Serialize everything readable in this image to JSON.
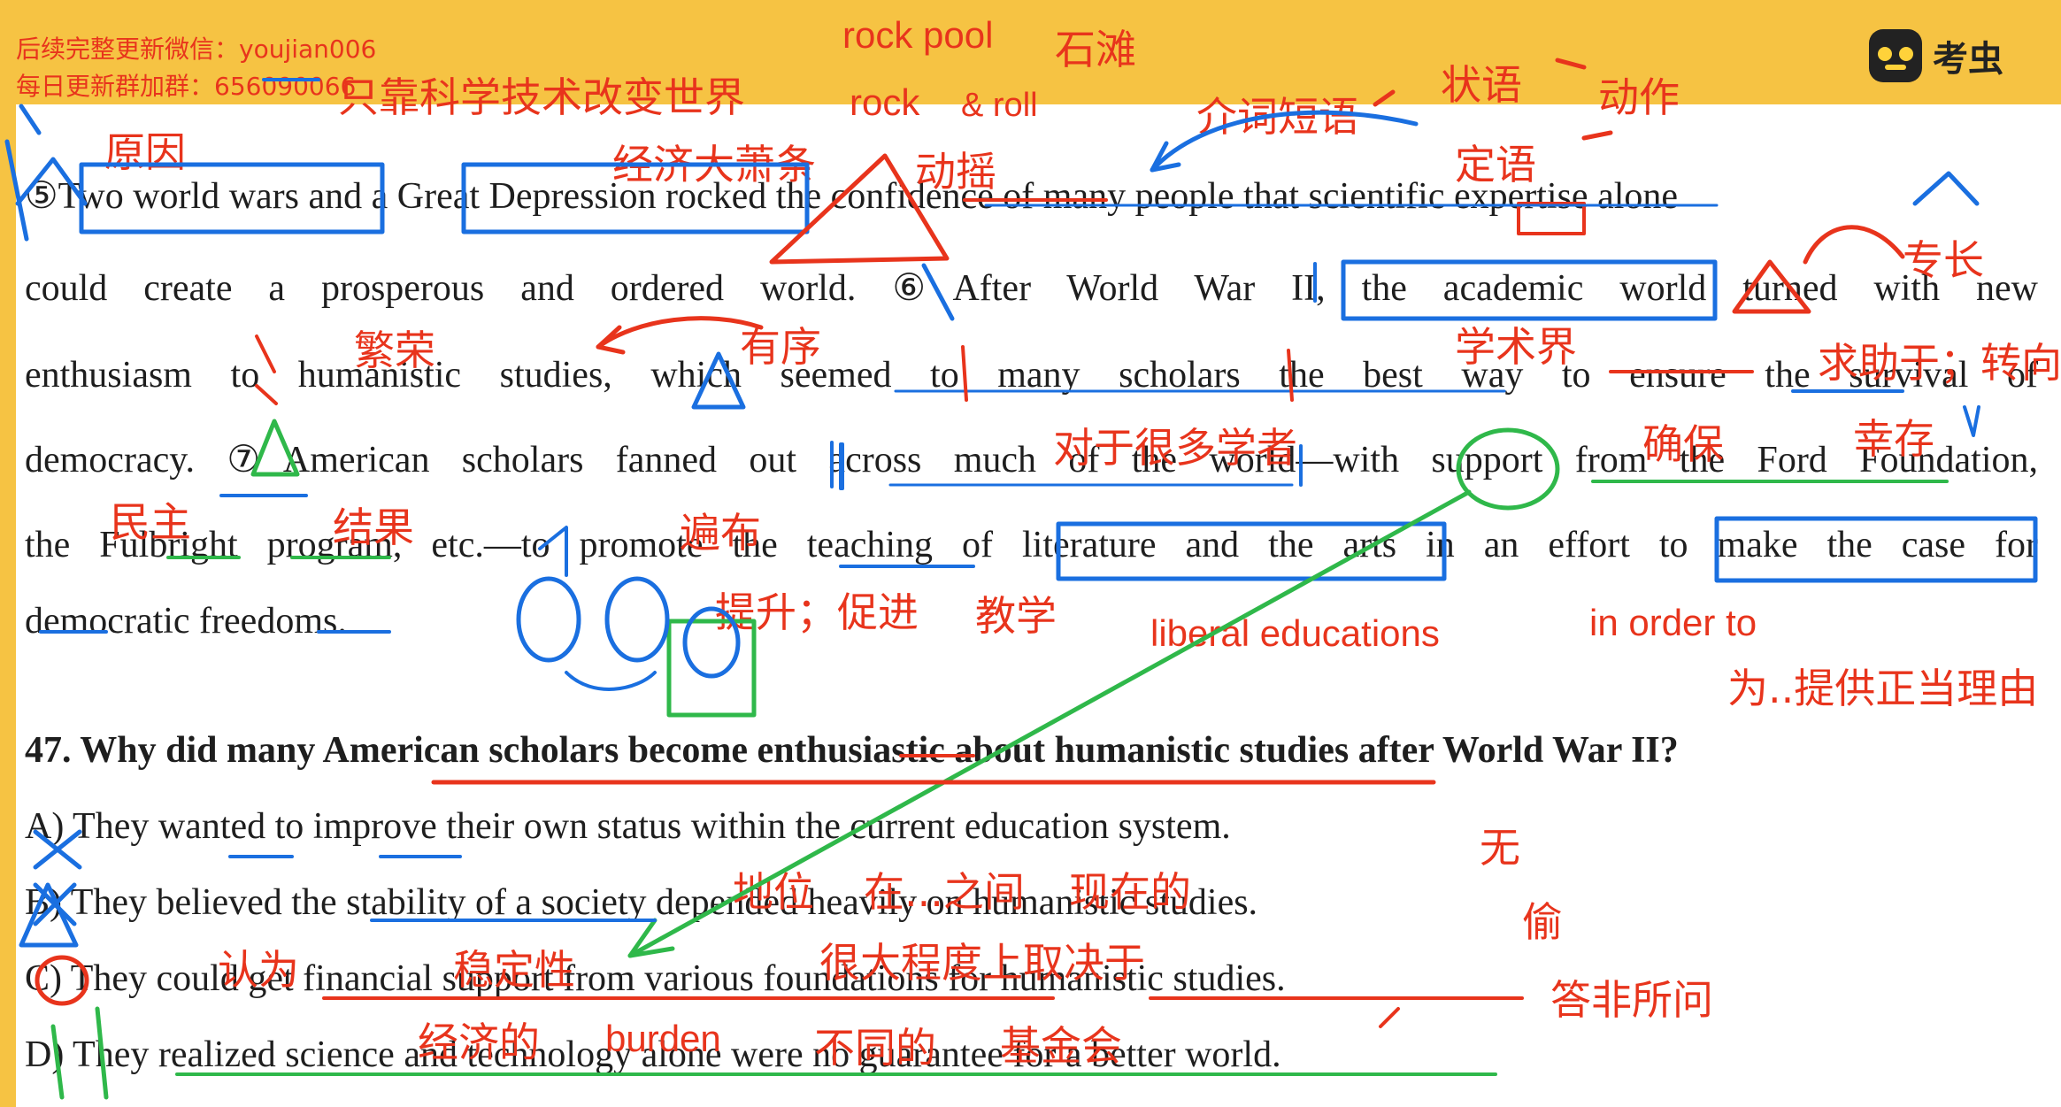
{
  "watermark": {
    "line1": "后续完整更新微信：youjian006",
    "line2": "每日更新群加群：656090066"
  },
  "header_note": "只靠科学技术改变世界",
  "brand": {
    "name": "考虫",
    "icon": "kaochong-logo-icon"
  },
  "passage": {
    "line1": [
      "⑤Two world wars and a Great Depression rocked the confidence of many people that scientific expertise alone"
    ],
    "line2": "could create a prosperous and ordered world. ⑥After World War II, the academic world turned with new",
    "line3": "enthusiasm to humanistic studies, which seemed to many scholars the best way to ensure the survival of",
    "line4": "democracy. ⑦American scholars fanned out across much of the world—with support from the Ford Foundation,",
    "line5": "the Fulbright program, etc.—to promote the teaching of literature and the arts in an effort to make the case for",
    "line6": "democratic freedoms."
  },
  "question": {
    "stem": "47. Why did many American scholars become enthusiastic about humanistic studies after World War II?",
    "options": [
      "A) They wanted to improve their own status within the current education system.",
      "B) They believed the stability of a society depended heavily on humanistic studies.",
      "C) They could get financial support from various foundations for humanistic studies.",
      "D) They realized science and technology alone were no guarantee for a better world."
    ]
  },
  "annotations": {
    "rock_pool": "rock pool",
    "shitan": "石滩",
    "rock_roll": "rock",
    "and_roll": "& roll",
    "reason": "原因",
    "depression": "经济大萧条",
    "shake": "动摇",
    "prep_phrase": "介词短语",
    "adverbial": "状语",
    "verb": "动作",
    "attributive": "定语",
    "expertise": "专长",
    "prosperous": "繁荣",
    "ordered": "有序",
    "academic": "学术界",
    "turn_to": "求助于；转向",
    "for_scholars": "对于很多学者",
    "ensure": "确保",
    "survival": "幸存",
    "democracy": "民主",
    "result": "结果",
    "spread": "遍布",
    "promote": "提升；促进",
    "teaching": "教学",
    "liberal": "liberal educations",
    "in_order_to": "in order to",
    "justify": "为..提供正当理由",
    "none": "无",
    "steal": "偷",
    "status": "地位",
    "within": "在...之间",
    "current": "现在的",
    "think": "认为",
    "stability": "稳定性",
    "depend": "很大程度上取决于",
    "irrelevant": "答非所问",
    "financial": "经济的",
    "burden": "burden",
    "various": "不同的",
    "foundation": "基金会"
  }
}
